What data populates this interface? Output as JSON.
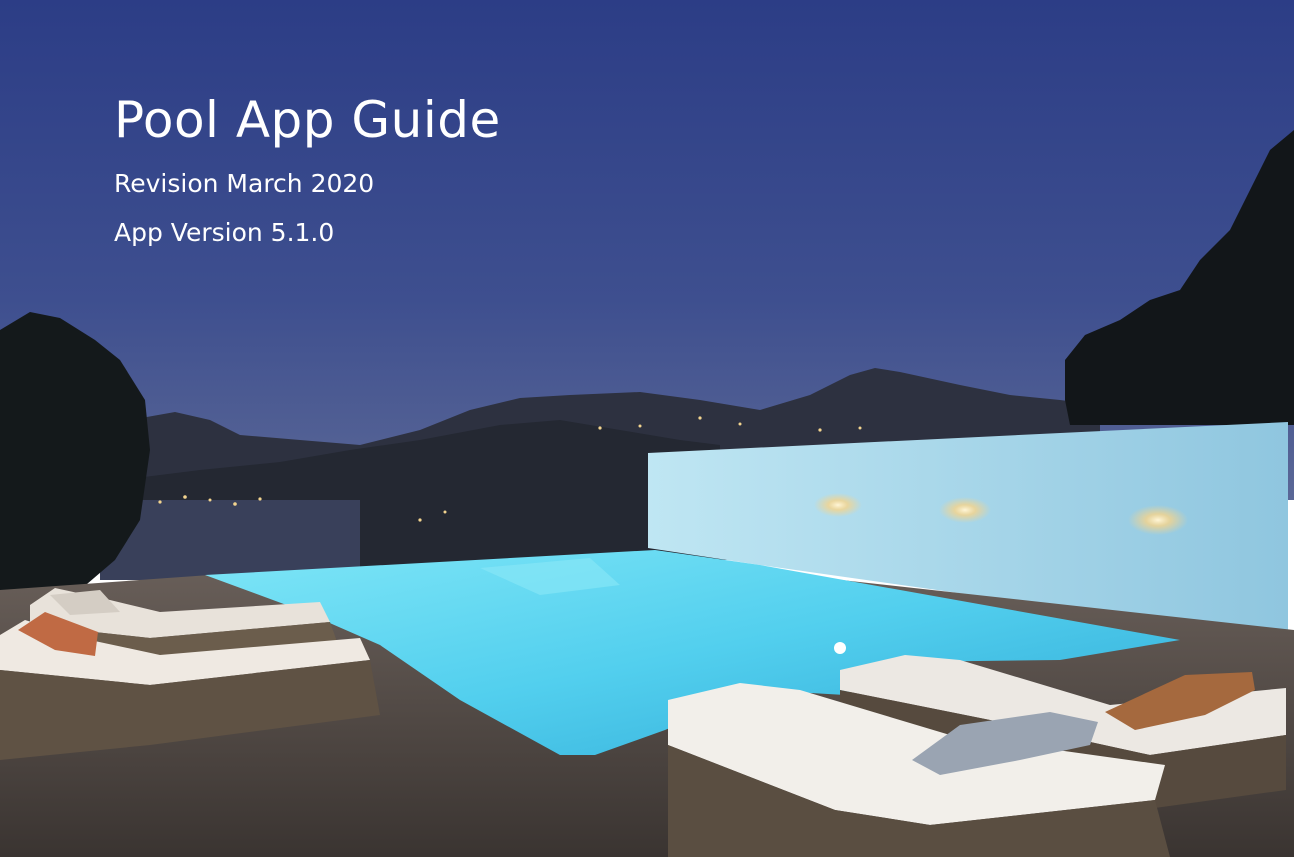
{
  "document": {
    "title": "Pool App Guide",
    "revision": "Revision March 2020",
    "app_version": "App Version 5.1.0"
  },
  "cover_image": {
    "subject": "illuminated infinity pool at dusk overlooking a bay",
    "colors": {
      "sky_top": "#2c3d86",
      "sky_bottom": "#4d5d93",
      "pool": "#5fd6ef",
      "wall": "#a7d8ea",
      "deck": "#4b4441"
    }
  }
}
